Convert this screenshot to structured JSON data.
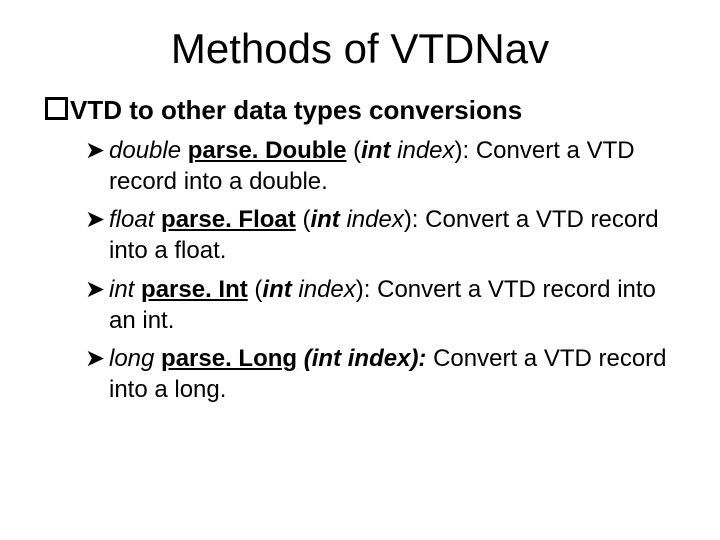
{
  "title": "Methods of VTDNav",
  "section_heading": "VTD to other data types conversions",
  "items": [
    {
      "ret_type": "double",
      "method": "parse. Double",
      "param_type": "int",
      "param_name": "index",
      "desc": "Convert a VTD record into a double."
    },
    {
      "ret_type": "float",
      "method": "parse. Float",
      "param_type": "int",
      "param_name": "index",
      "desc": "Convert a VTD record into a float."
    },
    {
      "ret_type": "int",
      "method": "parse. Int",
      "param_type": "int",
      "param_name": "index",
      "desc": "Convert a VTD record into an int."
    },
    {
      "ret_type": "long",
      "method": "parse. Long",
      "param_type": "int",
      "param_name": "index",
      "desc": "Convert a VTD record into a long.",
      "bold_paren": true
    }
  ]
}
